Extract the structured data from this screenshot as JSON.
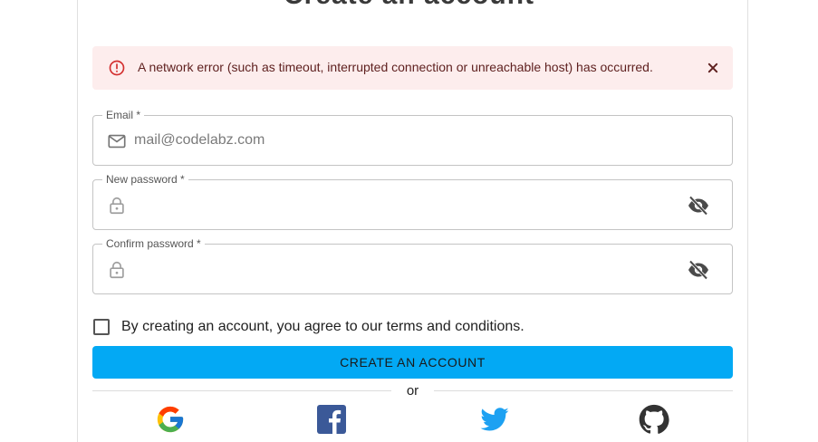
{
  "form": {
    "title": "Create an account"
  },
  "alert": {
    "message": "A network error (such as timeout, interrupted connection or unreachable host) has occurred.",
    "severity_color": "#d32f2f",
    "icon": "error-outline-icon",
    "close_icon": "close-icon"
  },
  "fields": {
    "email": {
      "label": "Email *",
      "placeholder": "mail@codelabz.com",
      "value": "",
      "icon": "mail-icon"
    },
    "new_password": {
      "label": "New password *",
      "value": "",
      "icon": "lock-icon",
      "toggle_icon": "visibility-off-icon"
    },
    "confirm_password": {
      "label": "Confirm password *",
      "value": "",
      "icon": "lock-icon",
      "toggle_icon": "visibility-off-icon"
    }
  },
  "terms": {
    "label": "By creating an account, you agree to our terms and conditions.",
    "checked": false
  },
  "submit": {
    "label": "CREATE AN ACCOUNT",
    "color": "#03a9f4"
  },
  "divider": {
    "label": "or"
  },
  "social": [
    {
      "name": "google",
      "icon": "google-icon"
    },
    {
      "name": "facebook",
      "icon": "facebook-icon",
      "color": "#3b5998"
    },
    {
      "name": "twitter",
      "icon": "twitter-icon",
      "color": "#1da1f2"
    },
    {
      "name": "github",
      "icon": "github-icon",
      "color": "#333333"
    }
  ]
}
